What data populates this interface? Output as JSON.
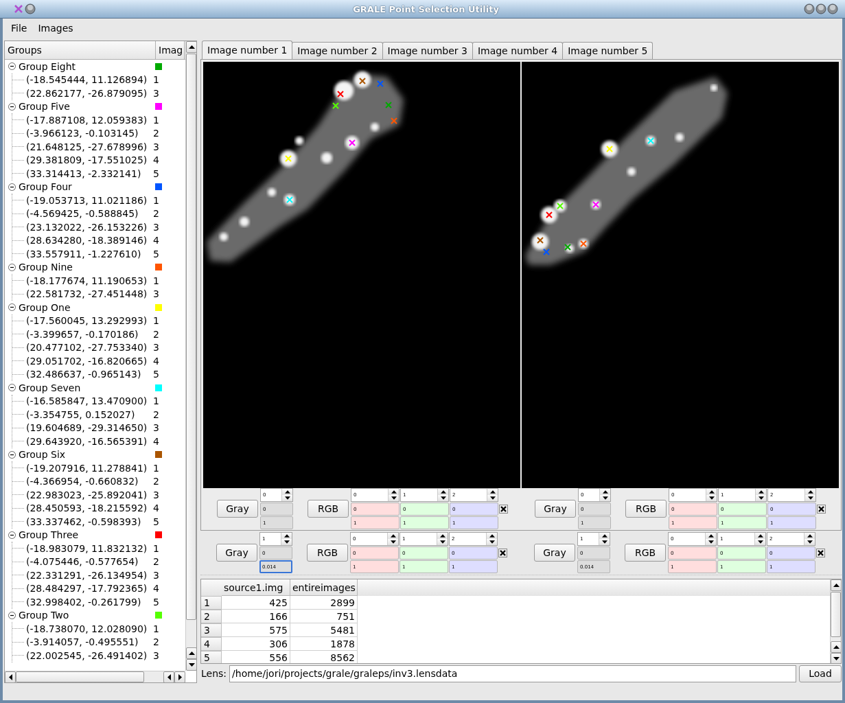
{
  "window": {
    "title": "GRALE Point Selection Utility"
  },
  "menu": [
    {
      "label": "File"
    },
    {
      "label": "Images"
    }
  ],
  "tree": {
    "columns": [
      "Groups",
      "Imag"
    ],
    "groups": [
      {
        "name": "Group Eight",
        "color": "#00aa00",
        "expanded": true,
        "children": [
          {
            "point": "(-18.545444, 11.126894)",
            "image": "1"
          },
          {
            "point": "(22.862177, -26.879095)",
            "image": "3"
          }
        ]
      },
      {
        "name": "Group Five",
        "color": "#ff00ff",
        "expanded": true,
        "children": [
          {
            "point": "(-17.887108, 12.059383)",
            "image": "1"
          },
          {
            "point": "(-3.966123, -0.103145)",
            "image": "2"
          },
          {
            "point": "(21.648125, -27.678996)",
            "image": "3"
          },
          {
            "point": "(29.381809, -17.551025)",
            "image": "4"
          },
          {
            "point": "(33.314413, -2.332141)",
            "image": "5"
          }
        ]
      },
      {
        "name": "Group Four",
        "color": "#0055ff",
        "expanded": true,
        "children": [
          {
            "point": "(-19.053713, 11.021186)",
            "image": "1"
          },
          {
            "point": "(-4.569425, -0.588845)",
            "image": "2"
          },
          {
            "point": "(23.132022, -26.153226)",
            "image": "3"
          },
          {
            "point": "(28.634280, -18.389146)",
            "image": "4"
          },
          {
            "point": "(33.557911, -1.227610)",
            "image": "5"
          }
        ]
      },
      {
        "name": "Group Nine",
        "color": "#ff5500",
        "expanded": true,
        "children": [
          {
            "point": "(-18.177674, 11.190653)",
            "image": "1"
          },
          {
            "point": "(22.581732, -27.451448)",
            "image": "3"
          }
        ]
      },
      {
        "name": "Group One",
        "color": "#ffff00",
        "expanded": true,
        "children": [
          {
            "point": "(-17.560045, 13.292993)",
            "image": "1"
          },
          {
            "point": "(-3.399657, -0.170186)",
            "image": "2"
          },
          {
            "point": "(20.477102, -27.753340)",
            "image": "3"
          },
          {
            "point": "(29.051702, -16.820665)",
            "image": "4"
          },
          {
            "point": "(32.486637, -0.965143)",
            "image": "5"
          }
        ]
      },
      {
        "name": "Group Seven",
        "color": "#00ffff",
        "expanded": true,
        "children": [
          {
            "point": "(-16.585847, 13.470900)",
            "image": "1"
          },
          {
            "point": "(-3.354755, 0.152027)",
            "image": "2"
          },
          {
            "point": "(19.604689, -29.314650)",
            "image": "3"
          },
          {
            "point": "(29.643920, -16.565391)",
            "image": "4"
          }
        ]
      },
      {
        "name": "Group Six",
        "color": "#aa5500",
        "expanded": true,
        "children": [
          {
            "point": "(-19.207916, 11.278841)",
            "image": "1"
          },
          {
            "point": "(-4.366954, -0.660832)",
            "image": "2"
          },
          {
            "point": "(22.983023, -25.892041)",
            "image": "3"
          },
          {
            "point": "(28.450593, -18.215592)",
            "image": "4"
          },
          {
            "point": "(33.337462, -0.598393)",
            "image": "5"
          }
        ]
      },
      {
        "name": "Group Three",
        "color": "#ff0000",
        "expanded": true,
        "children": [
          {
            "point": "(-18.983079, 11.832132)",
            "image": "1"
          },
          {
            "point": "(-4.075446, -0.577654)",
            "image": "2"
          },
          {
            "point": "(22.331291, -26.134954)",
            "image": "3"
          },
          {
            "point": "(28.484297, -17.792365)",
            "image": "4"
          },
          {
            "point": "(32.998402, -0.261799)",
            "image": "5"
          }
        ]
      },
      {
        "name": "Group Two",
        "color": "#55ff00",
        "expanded": true,
        "children": [
          {
            "point": "(-18.738070, 12.028090)",
            "image": "1"
          },
          {
            "point": "(-3.914057, -0.495551)",
            "image": "2"
          },
          {
            "point": "(22.002545, -26.491402)",
            "image": "3"
          }
        ]
      }
    ]
  },
  "tabs": [
    {
      "label": "Image number 1",
      "selected": true
    },
    {
      "label": "Image number 2",
      "selected": false
    },
    {
      "label": "Image number 3",
      "selected": false
    },
    {
      "label": "Image number 4",
      "selected": false
    },
    {
      "label": "Image number 5",
      "selected": false
    }
  ],
  "tab_controls": [
    {
      "gray_button": "Gray",
      "gray": {
        "channel": "0",
        "min": "0",
        "max": "1",
        "focused": false
      },
      "rgb_button": "RGB",
      "rgb": [
        {
          "channel": "0",
          "min": "0",
          "max": "1"
        },
        {
          "channel": "1",
          "min": "0",
          "max": "1"
        },
        {
          "channel": "2",
          "min": "0",
          "max": "1"
        }
      ]
    },
    {
      "gray_button": "Gray",
      "gray": {
        "channel": "0",
        "min": "0",
        "max": "1",
        "focused": false
      },
      "rgb_button": "RGB",
      "rgb": [
        {
          "channel": "0",
          "min": "0",
          "max": "1"
        },
        {
          "channel": "1",
          "min": "0",
          "max": "1"
        },
        {
          "channel": "2",
          "min": "0",
          "max": "1"
        }
      ]
    }
  ],
  "shared_controls": [
    {
      "gray_button": "Gray",
      "gray": {
        "channel": "1",
        "min": "0",
        "max": "0.014",
        "focused": true
      },
      "rgb_button": "RGB",
      "rgb": [
        {
          "channel": "0",
          "min": "0",
          "max": "1"
        },
        {
          "channel": "1",
          "min": "0",
          "max": "1"
        },
        {
          "channel": "2",
          "min": "0",
          "max": "1"
        }
      ]
    },
    {
      "gray_button": "Gray",
      "gray": {
        "channel": "1",
        "min": "0",
        "max": "0.014",
        "focused": false
      },
      "rgb_button": "RGB",
      "rgb": [
        {
          "channel": "0",
          "min": "0",
          "max": "1"
        },
        {
          "channel": "1",
          "min": "0",
          "max": "1"
        },
        {
          "channel": "2",
          "min": "0",
          "max": "1"
        }
      ]
    }
  ],
  "table": {
    "columns": [
      "source1.img",
      "entireimages"
    ],
    "rows": [
      {
        "header": "1",
        "cells": [
          "425",
          "2899"
        ]
      },
      {
        "header": "2",
        "cells": [
          "166",
          "751"
        ]
      },
      {
        "header": "3",
        "cells": [
          "575",
          "5481"
        ]
      },
      {
        "header": "4",
        "cells": [
          "306",
          "1878"
        ]
      },
      {
        "header": "5",
        "cells": [
          "556",
          "8562"
        ]
      }
    ]
  },
  "lens": {
    "label": "Lens:",
    "value": "/home/jori/projects/grale/graleps/inv3.lensdata",
    "button": "Load"
  }
}
